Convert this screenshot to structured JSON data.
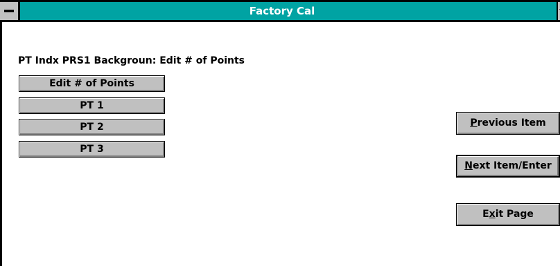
{
  "window": {
    "title": "Factory Cal"
  },
  "page": {
    "heading": "PT Indx PRS1 Backgroun: Edit # of Points"
  },
  "left_buttons": [
    {
      "label": "Edit # of Points"
    },
    {
      "label": "PT 1"
    },
    {
      "label": "PT 2"
    },
    {
      "label": "PT 3"
    }
  ],
  "right_buttons": {
    "previous": {
      "mnemonic": "P",
      "rest": "revious Item"
    },
    "next": {
      "mnemonic": "N",
      "rest": "ext Item/Enter"
    },
    "exit": {
      "pre": "E",
      "mnemonic": "x",
      "rest": "it Page"
    }
  },
  "colors": {
    "titlebar": "#00a3a3",
    "button_face": "#c0c0c0"
  }
}
